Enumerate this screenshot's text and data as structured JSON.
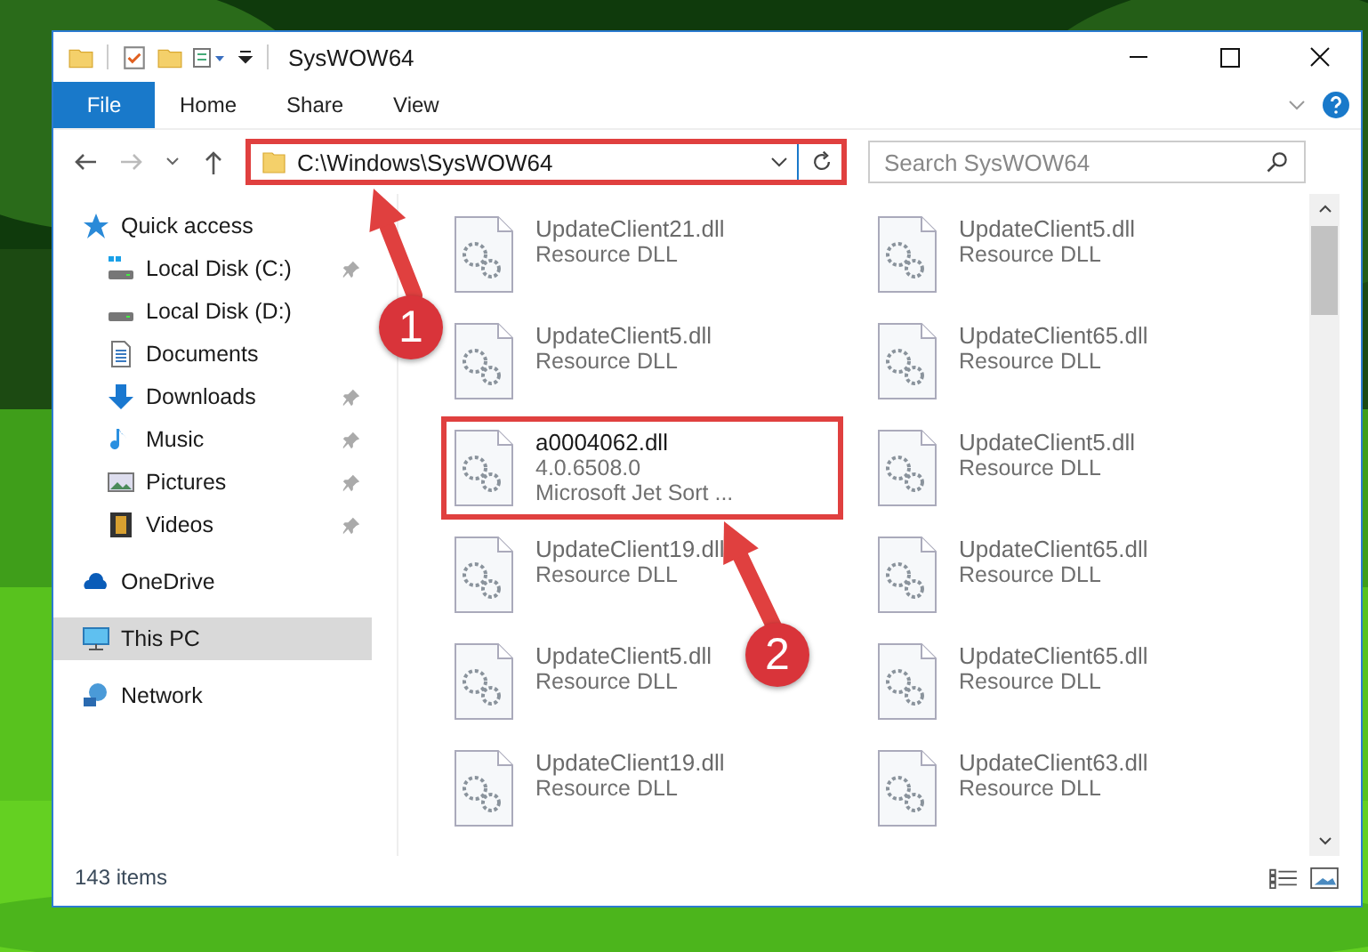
{
  "window": {
    "title": "SysWOW64"
  },
  "ribbon_tabs": [
    {
      "label": "File",
      "selected": true
    },
    {
      "label": "Home",
      "selected": false
    },
    {
      "label": "Share",
      "selected": false
    },
    {
      "label": "View",
      "selected": false
    }
  ],
  "address_bar": {
    "path": "C:\\Windows\\SysWOW64",
    "highlighted": true
  },
  "search": {
    "placeholder": "Search SysWOW64"
  },
  "sidebar": {
    "items": [
      {
        "label": "Quick access",
        "kind": "star",
        "selected": false,
        "children": [
          {
            "label": "Local Disk (C:)",
            "kind": "system-drive",
            "pinned": true,
            "selected": false
          },
          {
            "label": "Local Disk (D:)",
            "kind": "drive",
            "pinned": false,
            "selected": false
          },
          {
            "label": "Documents",
            "kind": "documents",
            "pinned": false,
            "selected": false
          },
          {
            "label": "Downloads",
            "kind": "downloads",
            "pinned": true,
            "selected": false
          },
          {
            "label": "Music",
            "kind": "music",
            "pinned": true,
            "selected": false
          },
          {
            "label": "Pictures",
            "kind": "pictures",
            "pinned": true,
            "selected": false
          },
          {
            "label": "Videos",
            "kind": "videos",
            "pinned": true,
            "selected": false
          }
        ]
      },
      {
        "label": "OneDrive",
        "kind": "cloud",
        "selected": false
      },
      {
        "label": "This PC",
        "kind": "computer",
        "selected": true
      },
      {
        "label": "Network",
        "kind": "network",
        "selected": false
      }
    ]
  },
  "files": [
    {
      "name": "UpdateClient21.dll",
      "lines": [
        "Resource DLL"
      ],
      "highlighted": false
    },
    {
      "name": "UpdateClient5.dll",
      "lines": [
        "Resource DLL"
      ],
      "highlighted": false
    },
    {
      "name": "UpdateClient5.dll",
      "lines": [
        "Resource DLL"
      ],
      "highlighted": false
    },
    {
      "name": "UpdateClient65.dll",
      "lines": [
        "Resource DLL"
      ],
      "highlighted": false
    },
    {
      "name": "a0004062.dll",
      "lines": [
        "4.0.6508.0",
        "Microsoft Jet Sort ..."
      ],
      "highlighted": true
    },
    {
      "name": "UpdateClient5.dll",
      "lines": [
        "Resource DLL"
      ],
      "highlighted": false
    },
    {
      "name": "UpdateClient19.dll",
      "lines": [
        "Resource DLL"
      ],
      "highlighted": false
    },
    {
      "name": "UpdateClient65.dll",
      "lines": [
        "Resource DLL"
      ],
      "highlighted": false
    },
    {
      "name": "UpdateClient5.dll",
      "lines": [
        "Resource DLL"
      ],
      "highlighted": false
    },
    {
      "name": "UpdateClient65.dll",
      "lines": [
        "Resource DLL"
      ],
      "highlighted": false
    },
    {
      "name": "UpdateClient19.dll",
      "lines": [
        "Resource DLL"
      ],
      "highlighted": false
    },
    {
      "name": "UpdateClient63.dll",
      "lines": [
        "Resource DLL"
      ],
      "highlighted": false
    }
  ],
  "status_bar": {
    "item_count": "143 items"
  },
  "annotations": [
    {
      "label": "1"
    },
    {
      "label": "2"
    }
  ]
}
